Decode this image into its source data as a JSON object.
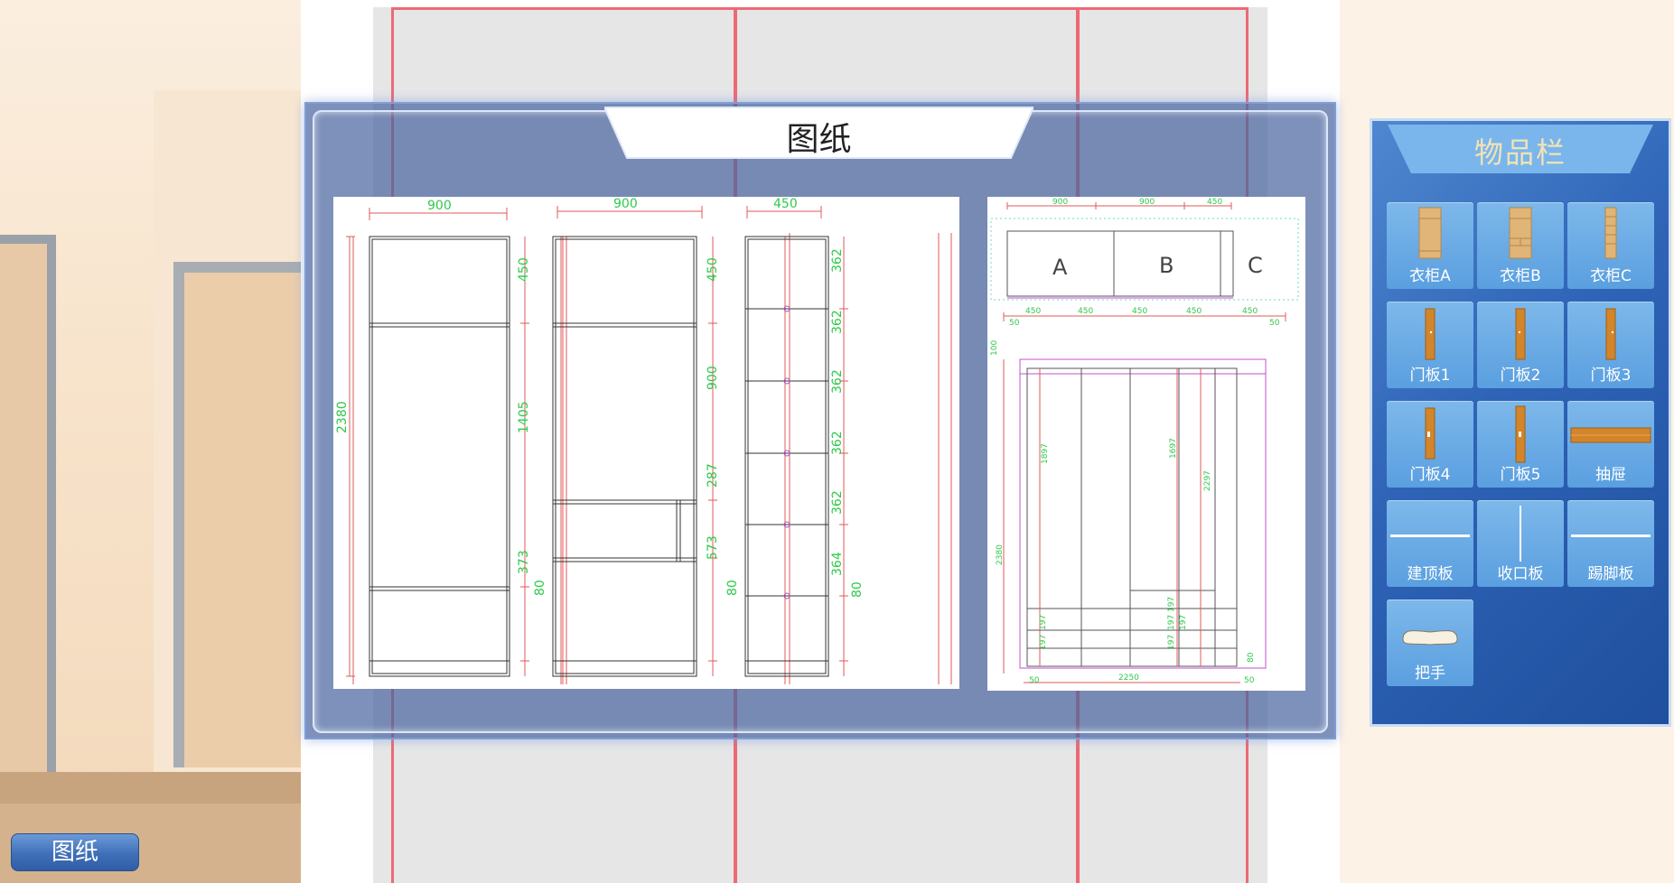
{
  "modal": {
    "title": "图纸"
  },
  "sheet_left": {
    "top_widths": [
      "900",
      "900",
      "450"
    ],
    "cab1": {
      "height": "2380",
      "parts": [
        "450",
        "1405",
        "373",
        "80"
      ]
    },
    "cab2": {
      "parts": [
        "450",
        "900",
        "287",
        "573",
        "80"
      ]
    },
    "cab3": {
      "parts": [
        "362",
        "362",
        "362",
        "362",
        "362",
        "364",
        "80"
      ]
    }
  },
  "sheet_right": {
    "top_widths": [
      "900",
      "900",
      "450"
    ],
    "cabinet_labels": [
      "A",
      "B",
      "C"
    ],
    "sub_widths": [
      "450",
      "450",
      "450",
      "450",
      "450"
    ],
    "edge_left": "50",
    "edge_right": "50",
    "top_gap": "100",
    "total_height": "2380",
    "inner_left": "1897",
    "inner_mid": "1697",
    "inner_right": "2297",
    "drawer_a": "197",
    "drawer_b": "197",
    "drawer_c": "197",
    "drawer_d": "197",
    "drawer_e": "197",
    "drawer_f": "197",
    "bottom_total": "2250",
    "base_height": "80"
  },
  "inventory": {
    "title": "物品栏",
    "items": [
      {
        "label": "衣柜A",
        "icon": "wardrobe-a-icon"
      },
      {
        "label": "衣柜B",
        "icon": "wardrobe-b-icon"
      },
      {
        "label": "衣柜C",
        "icon": "wardrobe-c-icon"
      },
      {
        "label": "门板1",
        "icon": "door-panel-icon"
      },
      {
        "label": "门板2",
        "icon": "door-panel-icon"
      },
      {
        "label": "门板3",
        "icon": "door-panel-icon"
      },
      {
        "label": "门板4",
        "icon": "door-panel-icon"
      },
      {
        "label": "门板5",
        "icon": "door-panel-icon"
      },
      {
        "label": "抽屉",
        "icon": "drawer-icon"
      },
      {
        "label": "建顶板",
        "icon": "top-board-icon"
      },
      {
        "label": "收口板",
        "icon": "closing-board-icon"
      },
      {
        "label": "踢脚板",
        "icon": "skirting-board-icon"
      },
      {
        "label": "把手",
        "icon": "handle-icon"
      }
    ]
  },
  "bottom_button": {
    "label": "图纸"
  }
}
